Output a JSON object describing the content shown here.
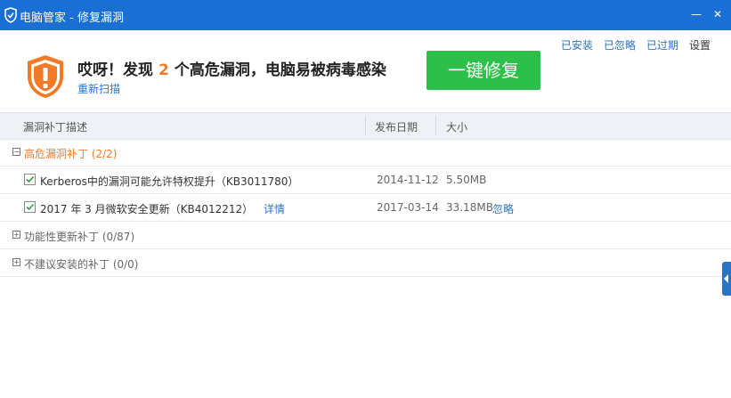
{
  "window": {
    "title": "电脑管家 - 修复漏洞",
    "minimize": "—",
    "close": "✕"
  },
  "header": {
    "alert_prefix": "哎呀！发现",
    "alert_count": "2",
    "alert_suffix": "个高危漏洞，电脑易被病毒感染",
    "rescan": "重新扫描",
    "fix_button": "一键修复",
    "links": {
      "installed": "已安装",
      "ignored": "已忽略",
      "expired": "已过期",
      "settings": "设置"
    }
  },
  "table": {
    "columns": {
      "description": "漏洞补丁描述",
      "date": "发布日期",
      "size": "大小"
    },
    "groups": [
      {
        "label": "高危漏洞补丁 (2/2)",
        "expander": "−",
        "items": [
          {
            "description": "Kerberos中的漏洞可能允许特权提升（KB3011780）",
            "date": "2014-11-12",
            "size": "5.50MB",
            "detail": "",
            "ignore": ""
          },
          {
            "description": "2017 年 3 月微软安全更新（KB4012212）",
            "date": "2017-03-14",
            "size": "33.18MB",
            "detail": "详情",
            "ignore": "忽略"
          }
        ]
      },
      {
        "label": "功能性更新补丁 (0/87)",
        "expander": "+"
      },
      {
        "label": "不建议安装的补丁 (0/0)",
        "expander": "+"
      }
    ]
  },
  "colors": {
    "titlebar": "#1a6fd4",
    "accent_orange": "#f07a25",
    "link_blue": "#2a74c8",
    "fix_green": "#2cc04a"
  }
}
